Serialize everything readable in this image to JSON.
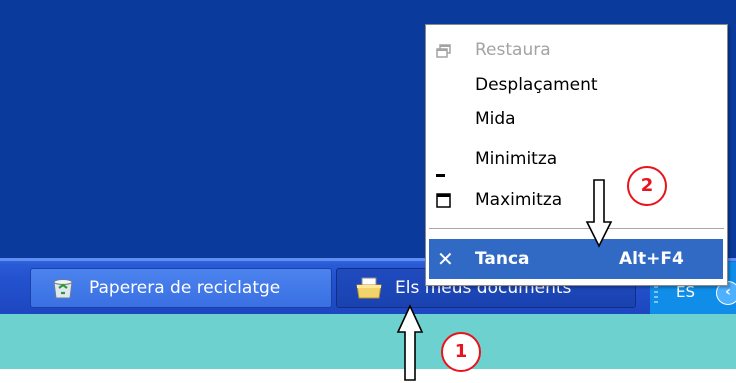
{
  "context_menu": {
    "items": [
      {
        "label": "Restaura",
        "icon": "restore-icon",
        "enabled": false
      },
      {
        "label": "Desplaçament",
        "icon": "",
        "enabled": true
      },
      {
        "label": "Mida",
        "icon": "",
        "enabled": true
      },
      {
        "label": "Minimitza",
        "icon": "minimize-icon",
        "enabled": true
      },
      {
        "label": "Maximitza",
        "icon": "maximize-icon",
        "enabled": true
      }
    ],
    "close": {
      "label": "Tanca",
      "shortcut": "Alt+F4",
      "icon": "close-icon"
    }
  },
  "taskbar": {
    "buttons": [
      {
        "label": "Paperera de reciclatge",
        "icon": "recycle-bin-icon",
        "active": false
      },
      {
        "label": "Els meus documents",
        "icon": "my-documents-icon",
        "active": true
      }
    ],
    "tray": {
      "language": "ES"
    }
  },
  "annotations": {
    "callout_1": "1",
    "callout_2": "2"
  },
  "colors": {
    "desktop": "#0a3a9c",
    "taskbar": "#2452cf",
    "menu_highlight": "#316ac5",
    "callout_red": "#e8141c",
    "bottom_band": "#6cd1cf"
  }
}
